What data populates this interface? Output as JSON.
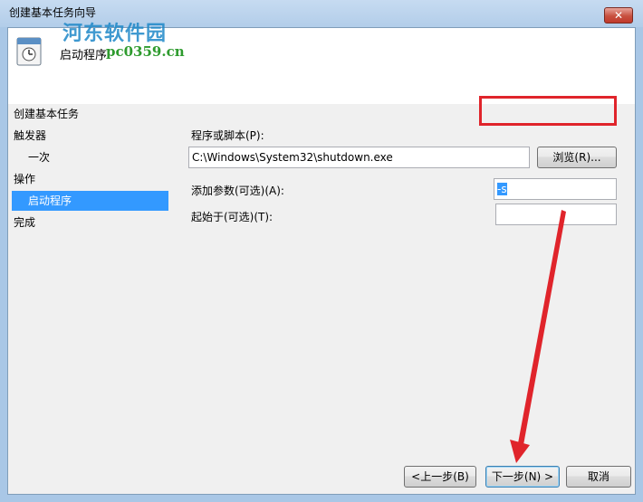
{
  "window": {
    "title": "创建基本任务向导",
    "close_label": "✕"
  },
  "header": {
    "title": "启动程序",
    "icon": "task-scheduler-icon"
  },
  "watermark": {
    "name": "河东软件园",
    "url": "pc0359.cn"
  },
  "steps": {
    "heading": "创建基本任务",
    "items": [
      {
        "label": "触发器"
      },
      {
        "label": "一次"
      },
      {
        "label": "操作"
      },
      {
        "label": "启动程序"
      },
      {
        "label": "完成"
      }
    ]
  },
  "form": {
    "program_label": "程序或脚本(P):",
    "program_value": "C:\\Windows\\System32\\shutdown.exe",
    "browse_label": "浏览(R)...",
    "args_label": "添加参数(可选)(A):",
    "args_value": "-s",
    "start_in_label": "起始于(可选)(T):",
    "start_in_value": ""
  },
  "buttons": {
    "back": "<上一步(B)",
    "next": "下一步(N) >",
    "cancel": "取消"
  },
  "annotation": {
    "color": "#e0242b"
  }
}
